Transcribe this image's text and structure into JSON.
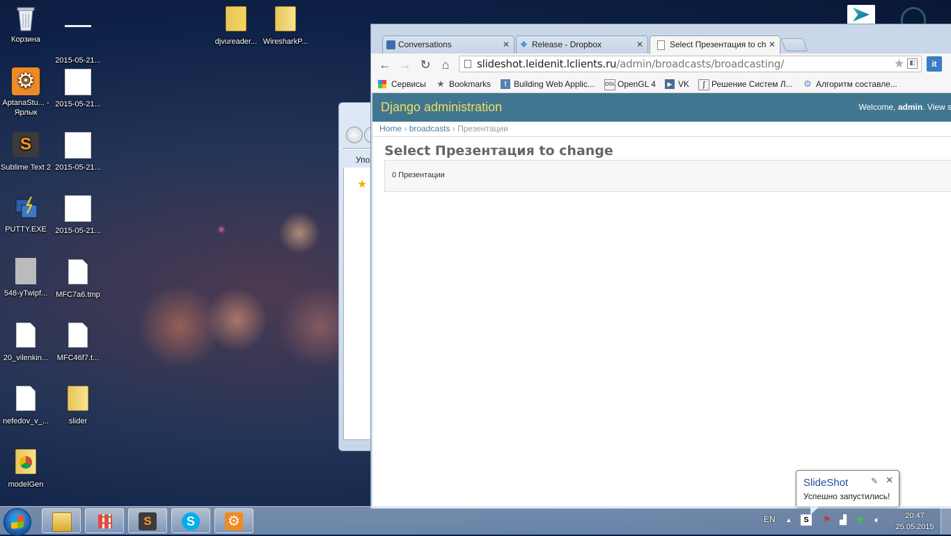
{
  "desktop": {
    "icons": [
      {
        "label": "Корзина"
      },
      {
        "label": "2015-05-21..."
      },
      {
        "label": "djvureader..."
      },
      {
        "label": "WiresharkP..."
      },
      {
        "label": "AptanaStu... - Ярлык"
      },
      {
        "label": "2015-05-21..."
      },
      {
        "label": "Sublime Text 2"
      },
      {
        "label": "2015-05-21..."
      },
      {
        "label": "PUTTY.EXE"
      },
      {
        "label": "2015-05-21..."
      },
      {
        "label": "548-yTwipf..."
      },
      {
        "label": "MFC7a6.tmp"
      },
      {
        "label": "20_vilenkin..."
      },
      {
        "label": "MFC46f7.t..."
      },
      {
        "label": "nefedov_v_..."
      },
      {
        "label": "slider"
      },
      {
        "label": "modelGen"
      }
    ]
  },
  "explorer": {
    "toolbar_label": "Упо"
  },
  "browser": {
    "tabs": [
      {
        "label": "Conversations",
        "close": "✕"
      },
      {
        "label": "Release - Dropbox",
        "close": "✕"
      },
      {
        "label": "Select Презентация to ch",
        "close": "✕"
      }
    ],
    "url_host": "slideshot.leidenit.lclients.ru",
    "url_path": "/admin/broadcasts/broadcasting/",
    "ext_label": "it",
    "bookmarks": [
      {
        "label": "Сервисы",
        "icon": "apps-grid-icon"
      },
      {
        "label": "Bookmarks",
        "icon": "star-icon"
      },
      {
        "label": "Building Web Applic...",
        "icon": "t-icon"
      },
      {
        "label": "OpenGL 4",
        "icon": "ogl-icon"
      },
      {
        "label": "VK",
        "icon": "play-icon"
      },
      {
        "label": "Решение Систем Л...",
        "icon": "formula-icon"
      },
      {
        "label": "Алгоритм составле...",
        "icon": "gear-icon"
      }
    ]
  },
  "page": {
    "header_title": "Django administration",
    "welcome_prefix": "Welcome, ",
    "welcome_user": "admin",
    "welcome_suffix": ". View sit",
    "crumbs": {
      "home": "Home",
      "app": "broadcasts",
      "sep": "›",
      "current": "Презентации"
    },
    "title": "Select Презентация to change",
    "result_count": "0 Презентации"
  },
  "taskbar": {
    "language": "EN",
    "time": "20:47",
    "date": "25.05.2015"
  },
  "notification": {
    "title": "SlideShot",
    "message": "Успешно запустились!"
  },
  "colors": {
    "django_header": "#417690",
    "django_title": "#f5dd5d",
    "link": "#447e9b"
  }
}
